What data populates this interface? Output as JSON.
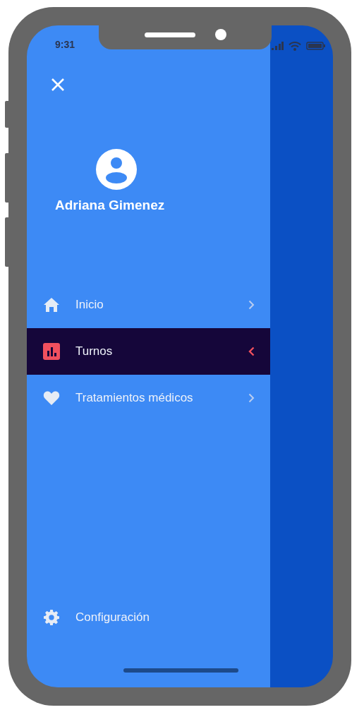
{
  "status_bar": {
    "time": "9:31"
  },
  "user": {
    "name": "Adriana Gimenez"
  },
  "menu": [
    {
      "label": "Inicio",
      "selected": false
    },
    {
      "label": "Turnos",
      "selected": true
    },
    {
      "label": "Tratamientos médicos",
      "selected": false
    }
  ],
  "footer_item": {
    "label": "Configuración"
  }
}
